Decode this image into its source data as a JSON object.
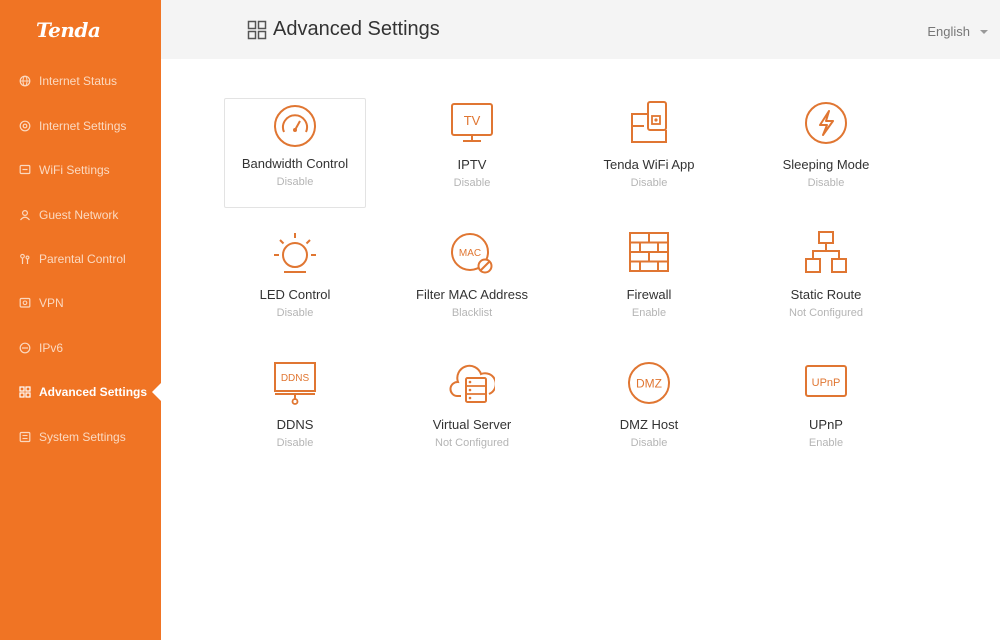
{
  "brand": {
    "logo": "Tenda",
    "accent": "#f07424",
    "icon_color": "#e07632"
  },
  "sidebar": {
    "items": [
      {
        "label": "Internet Status",
        "icon": "globe-icon",
        "active": false
      },
      {
        "label": "Internet Settings",
        "icon": "settings-icon",
        "active": false
      },
      {
        "label": "WiFi Settings",
        "icon": "wifi-icon",
        "active": false
      },
      {
        "label": "Guest Network",
        "icon": "guest-icon",
        "active": false
      },
      {
        "label": "Parental Control",
        "icon": "parental-icon",
        "active": false
      },
      {
        "label": "VPN",
        "icon": "vpn-icon",
        "active": false
      },
      {
        "label": "IPv6",
        "icon": "ipv6-icon",
        "active": false
      },
      {
        "label": "Advanced Settings",
        "icon": "grid-icon",
        "active": true
      },
      {
        "label": "System Settings",
        "icon": "system-icon",
        "active": false
      }
    ]
  },
  "header": {
    "title": "Advanced Settings",
    "title_icon": "grid-icon",
    "language": "English"
  },
  "features": [
    {
      "name": "Bandwidth Control",
      "status": "Disable",
      "icon": "speedometer-icon",
      "selected": true
    },
    {
      "name": "IPTV",
      "status": "Disable",
      "icon": "tv-icon",
      "icon_text": "TV"
    },
    {
      "name": "Tenda WiFi App",
      "status": "Disable",
      "icon": "phone-app-icon"
    },
    {
      "name": "Sleeping Mode",
      "status": "Disable",
      "icon": "lightning-icon"
    },
    {
      "name": "LED Control",
      "status": "Disable",
      "icon": "sun-icon"
    },
    {
      "name": "Filter MAC Address",
      "status": "Blacklist",
      "icon": "mac-filter-icon",
      "icon_text": "MAC"
    },
    {
      "name": "Firewall",
      "status": "Enable",
      "icon": "brick-wall-icon"
    },
    {
      "name": "Static Route",
      "status": "Not Configured",
      "icon": "route-icon"
    },
    {
      "name": "DDNS",
      "status": "Disable",
      "icon": "ddns-icon",
      "icon_text": "DDNS"
    },
    {
      "name": "Virtual Server",
      "status": "Not Configured",
      "icon": "cloud-server-icon"
    },
    {
      "name": "DMZ Host",
      "status": "Disable",
      "icon": "dmz-icon",
      "icon_text": "DMZ"
    },
    {
      "name": "UPnP",
      "status": "Enable",
      "icon": "upnp-icon",
      "icon_text": "UPnP"
    }
  ]
}
